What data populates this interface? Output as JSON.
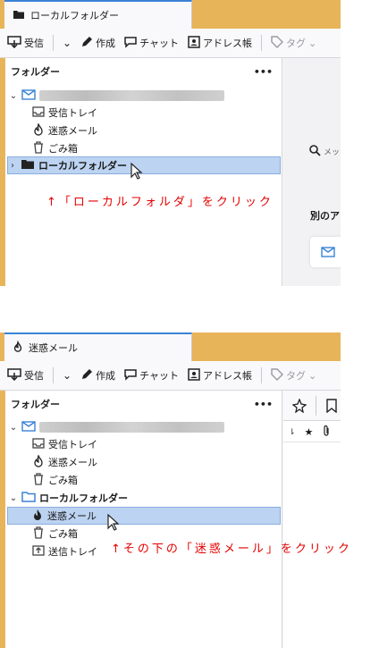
{
  "screenshot1": {
    "tab_title": "ローカルフォルダー",
    "toolbar": {
      "get_mail": "受信",
      "compose": "作成",
      "chat": "チャット",
      "address_book": "アドレス帳",
      "tag": "タグ"
    },
    "folder_pane": {
      "header": "フォルダー",
      "more": "•••",
      "items": [
        {
          "label": "受信トレイ"
        },
        {
          "label": "迷惑メール"
        },
        {
          "label": "ごみ箱"
        },
        {
          "label": "ローカルフォルダー"
        }
      ]
    },
    "right_pane": {
      "search_placeholder": "メッ",
      "section_label": "別のア"
    },
    "annotation": "↑「ローカルフォルダ」をクリック"
  },
  "screenshot2": {
    "tab_title": "迷惑メール",
    "toolbar": {
      "get_mail": "受信",
      "compose": "作成",
      "chat": "チャット",
      "address_book": "アドレス帳",
      "tag": "タグ"
    },
    "folder_pane": {
      "header": "フォルダー",
      "more": "•••",
      "items": [
        {
          "label": "受信トレイ"
        },
        {
          "label": "迷惑メール"
        },
        {
          "label": "ごみ箱"
        },
        {
          "label": "ローカルフォルダー"
        },
        {
          "label": "迷惑メール"
        },
        {
          "label": "ごみ箱"
        },
        {
          "label": "送信トレイ"
        }
      ]
    },
    "annotation": "↑その下の「迷惑メール」をクリック"
  }
}
